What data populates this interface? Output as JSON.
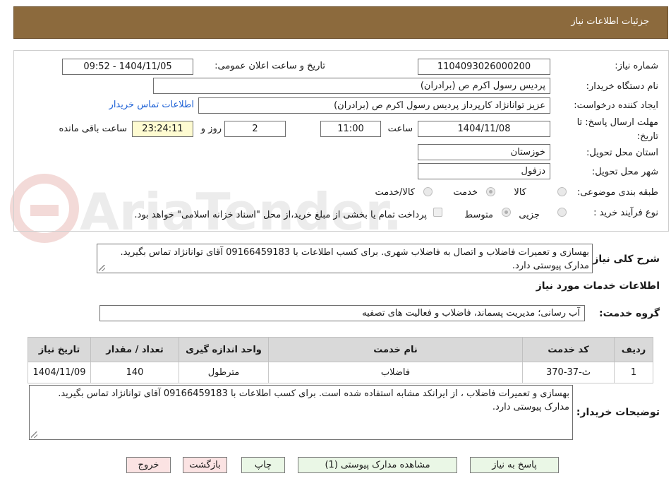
{
  "header": {
    "title": "جزئیات اطلاعات نیاز"
  },
  "fields": {
    "need_number_label": "شماره نیاز:",
    "need_number": "1104093026000200",
    "announce_label": "تاریخ و ساعت اعلان عمومی:",
    "announce_value": "1404/11/05 - 09:52",
    "buyer_org_label": "نام دستگاه خریدار:",
    "buyer_org": "پردیس رسول اکرم ص (برادران)",
    "requester_label": "ایجاد کننده درخواست:",
    "requester": "عزیز توانانژاد کارپرداز پردیس رسول اکرم ص (برادران)",
    "contact_link": "اطلاعات تماس خریدار",
    "deadline_label": "مهلت ارسال پاسخ: تا تاریخ:",
    "deadline_date": "1404/11/08",
    "time_label": "ساعت",
    "deadline_time": "11:00",
    "days": "2",
    "days_label": "روز و",
    "remaining_time": "23:24:11",
    "remaining_label": "ساعت باقی مانده",
    "province_label": "استان محل تحویل:",
    "province": "خوزستان",
    "city_label": "شهر محل تحویل:",
    "city": "دزفول",
    "category_label": "طبقه بندی موضوعی:",
    "category_options": [
      "کالا",
      "خدمت",
      "کالا/خدمت"
    ],
    "category_selected": "خدمت",
    "process_label": "نوع فرآیند خرید :",
    "process_options": [
      "جزیی",
      "متوسط"
    ],
    "process_selected": "متوسط",
    "payment_note": "پرداخت تمام یا بخشی از مبلغ خرید،از محل \"اسناد خزانه اسلامی\" خواهد بود."
  },
  "description": {
    "label": "شرح کلی نیاز:",
    "text": "بهسازی و تعمیرات فاضلاب و اتصال به فاضلاب شهری. برای کسب اطلاعات با 09166459183 آقای توانانژاد تماس بگیرید. مدارک پیوستی دارد."
  },
  "services": {
    "section_title": "اطلاعات خدمات مورد نیاز",
    "group_label": "گروه خدمت:",
    "group_value": "آب رسانی؛ مدیریت پسماند، فاضلاب و فعالیت های تصفیه",
    "columns": [
      "ردیف",
      "کد خدمت",
      "نام خدمت",
      "واحد اندازه گیری",
      "تعداد / مقدار",
      "تاریخ نیاز"
    ],
    "rows": [
      [
        "1",
        "ث-37-370",
        "فاضلاب",
        "مترطول",
        "140",
        "1404/11/09"
      ]
    ]
  },
  "buyer_notes": {
    "label": "توضیحات خریدار:",
    "text": "بهسازی و تعمیرات فاضلاب ، از ایرانکد مشابه استفاده شده است. برای کسب اطلاعات با 09166459183 آقای توانانژاد تماس بگیرید. مدارک پیوستی دارد."
  },
  "buttons": {
    "reply": "پاسخ به نیاز",
    "attachments": "مشاهده مدارک پیوستی (1)",
    "print": "چاپ",
    "back": "بازگشت",
    "exit": "خروج"
  },
  "watermark": "AriaTender.neT"
}
